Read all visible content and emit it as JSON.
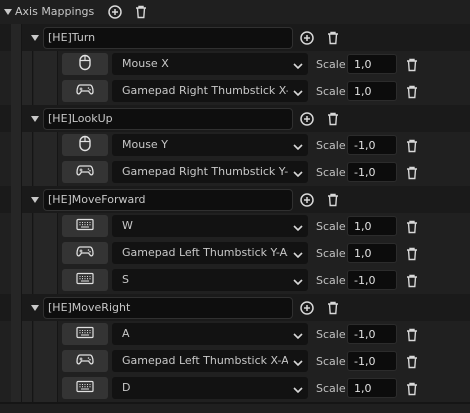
{
  "panel": {
    "title": "Axis Mappings",
    "add_icon": "plus-circle-icon",
    "delete_icon": "trash-icon"
  },
  "scale_label": "Scale",
  "mappings": [
    {
      "name": "[HE]Turn",
      "keys": [
        {
          "device": "mouse-icon",
          "key": "Mouse X",
          "scale": "1,0"
        },
        {
          "device": "gamepad-icon",
          "key": "Gamepad Right Thumbstick X-Axis",
          "scale": "1,0"
        }
      ]
    },
    {
      "name": "[HE]LookUp",
      "keys": [
        {
          "device": "mouse-icon",
          "key": "Mouse Y",
          "scale": "-1,0"
        },
        {
          "device": "gamepad-icon",
          "key": "Gamepad Right Thumbstick Y-Axis",
          "scale": "-1,0"
        }
      ]
    },
    {
      "name": "[HE]MoveForward",
      "keys": [
        {
          "device": "keyboard-icon",
          "key": "W",
          "scale": "1,0"
        },
        {
          "device": "gamepad-icon",
          "key": "Gamepad Left Thumbstick Y-Axis",
          "scale": "1,0"
        },
        {
          "device": "keyboard-icon",
          "key": "S",
          "scale": "-1,0"
        }
      ]
    },
    {
      "name": "[HE]MoveRight",
      "keys": [
        {
          "device": "keyboard-icon",
          "key": "A",
          "scale": "-1,0"
        },
        {
          "device": "gamepad-icon",
          "key": "Gamepad Left Thumbstick X-Axis",
          "scale": "-1,0"
        },
        {
          "device": "keyboard-icon",
          "key": "D",
          "scale": "1,0"
        }
      ]
    }
  ]
}
